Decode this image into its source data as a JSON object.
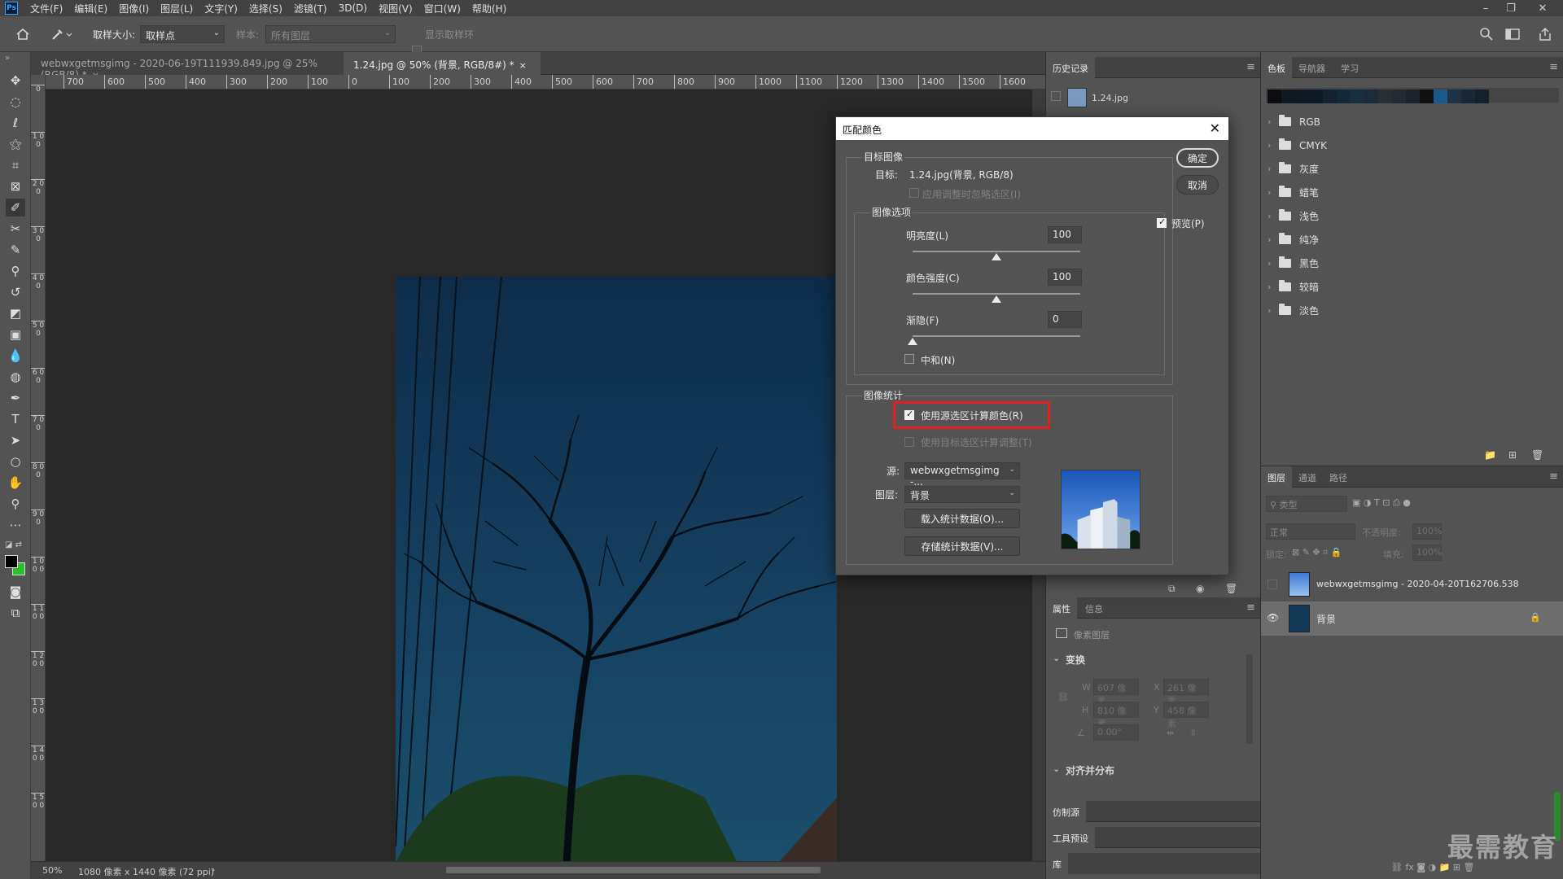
{
  "app": {
    "logo_text": "Ps"
  },
  "menu": [
    "文件(F)",
    "编辑(E)",
    "图像(I)",
    "图层(L)",
    "文字(Y)",
    "选择(S)",
    "滤镜(T)",
    "3D(D)",
    "视图(V)",
    "窗口(W)",
    "帮助(H)"
  ],
  "window_controls": {
    "minimize": "–",
    "restore": "❐",
    "close": "✕"
  },
  "options_bar": {
    "sample_size_label": "取样大小:",
    "sample_size_value": "取样点",
    "sample_label": "样本:",
    "sample_value": "所有图层",
    "show_ring_label": "显示取样环"
  },
  "tabs": [
    {
      "label": "webwxgetmsgimg - 2020-06-19T111939.849.jpg @ 25%(RGB/8) *",
      "close": "×"
    },
    {
      "label": "1.24.jpg @ 50% (背景, RGB/8#) *",
      "close": "×"
    }
  ],
  "ruler_h": [
    "700",
    "600",
    "500",
    "400",
    "300",
    "200",
    "100",
    "0",
    "100",
    "200",
    "300",
    "400",
    "500",
    "600",
    "700",
    "800",
    "900",
    "1000",
    "1100",
    "1200",
    "1300",
    "1400",
    "1500",
    "1600"
  ],
  "ruler_v": [
    "0",
    "1 0 0",
    "2 0 0",
    "3 0 0",
    "4 0 0",
    "5 0 0",
    "6 0 0",
    "7 0 0",
    "8 0 0",
    "9 0 0",
    "1 0 0 0",
    "1 1 0 0",
    "1 2 0 0",
    "1 3 0 0",
    "1 4 0 0",
    "1 5 0 0"
  ],
  "status": {
    "zoom": "50%",
    "doc_info": "1080 像素 x 1440 像素 (72 ppi)",
    "arrow": "›"
  },
  "history_panel": {
    "tab": "历史记录",
    "item": "1.24.jpg"
  },
  "swatches_panel": {
    "tabs": [
      "色板",
      "导航器",
      "学习"
    ],
    "swatch_colors": [
      "#0b0d10",
      "#101820",
      "#111a24",
      "#0f1a27",
      "#122230",
      "#142a39",
      "#17303f",
      "#1c2b37",
      "#2a2f35",
      "#232a31",
      "#1c232a",
      "#101010",
      "#1b5a8d",
      "#1e3244",
      "#1a2835",
      "#14202b"
    ],
    "folders": [
      "RGB",
      "CMYK",
      "灰度",
      "蜡笔",
      "浅色",
      "纯净",
      "黑色",
      "较暗",
      "淡色"
    ]
  },
  "layers_panel": {
    "tabs": [
      "图层",
      "通道",
      "路径"
    ],
    "filter_placeholder": "类型",
    "blend_mode": "正常",
    "opacity_label": "不透明度:",
    "opacity_value": "100%",
    "lock_label": "锁定:",
    "fill_label": "填充:",
    "fill_value": "100%",
    "layers": [
      {
        "name": "webwxgetmsgimg - 2020-04-20T162706.538",
        "visible": false
      },
      {
        "name": "背景",
        "visible": true,
        "locked": true
      }
    ]
  },
  "properties_panel": {
    "tabs": [
      "属性",
      "信息"
    ],
    "kind": "像素图层",
    "transform_label": "变换",
    "w_label": "W",
    "w_value": "607 像素",
    "x_label": "X",
    "x_value": "261 像素",
    "h_label": "H",
    "h_value": "810 像素",
    "y_label": "Y",
    "y_value": "458 像素",
    "angle_value": "0.00°",
    "align_label": "对齐并分布"
  },
  "collapsed_panels": [
    "仿制源",
    "工具预设",
    "库"
  ],
  "dialog": {
    "title": "匹配颜色",
    "close": "✕",
    "target_group": "目标图像",
    "target_label": "目标:",
    "target_value": "1.24.jpg(背景, RGB/8)",
    "ignore_selection": "应用调整时忽略选区(I)",
    "image_options_group": "图像选项",
    "luminance_label": "明亮度(L)",
    "luminance_value": "100",
    "luminance_frac": 0.5,
    "intensity_label": "颜色强度(C)",
    "intensity_value": "100",
    "intensity_frac": 0.5,
    "fade_label": "渐隐(F)",
    "fade_value": "0",
    "fade_frac": 0,
    "neutralize_label": "中和(N)",
    "stats_group": "图像统计",
    "use_source_sel": "使用源选区计算颜色(R)",
    "use_target_sel": "使用目标选区计算调整(T)",
    "source_label": "源:",
    "source_value": "webwxgetmsgimg -...",
    "layer_label": "图层:",
    "layer_value": "背景",
    "load_stats": "载入统计数据(O)...",
    "save_stats": "存储统计数据(V)...",
    "ok": "确定",
    "cancel": "取消",
    "preview_label": "预览(P)"
  },
  "watermark": "最需教育"
}
